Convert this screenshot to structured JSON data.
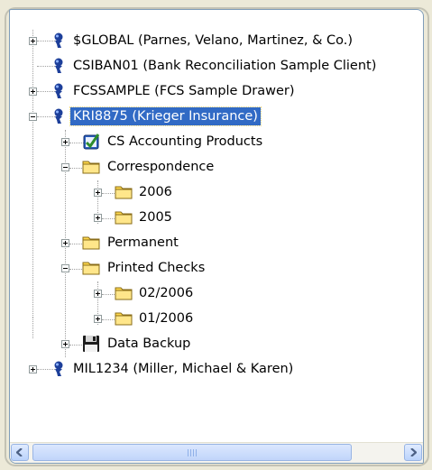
{
  "tree": {
    "items": [
      {
        "label": "$GLOBAL (Parnes, Velano, Martinez, & Co.)",
        "icon": "drawer-icon",
        "toggle": "plus"
      },
      {
        "label": "CSIBAN01 (Bank Reconciliation Sample Client)",
        "icon": "drawer-icon",
        "toggle": "none"
      },
      {
        "label": "FCSSAMPLE (FCS Sample Drawer)",
        "icon": "drawer-icon",
        "toggle": "plus"
      },
      {
        "label": "KRI8875 (Krieger Insurance)",
        "icon": "drawer-icon",
        "toggle": "minus",
        "selected": true
      },
      {
        "label": "CS Accounting Products",
        "icon": "cs-accounting-icon",
        "toggle": "plus"
      },
      {
        "label": "Correspondence",
        "icon": "folder-icon",
        "toggle": "minus"
      },
      {
        "label": "2006",
        "icon": "folder-icon",
        "toggle": "plus"
      },
      {
        "label": "2005",
        "icon": "folder-icon",
        "toggle": "plus"
      },
      {
        "label": "Permanent",
        "icon": "folder-icon",
        "toggle": "plus"
      },
      {
        "label": "Printed Checks",
        "icon": "folder-icon",
        "toggle": "minus"
      },
      {
        "label": "02/2006",
        "icon": "folder-icon",
        "toggle": "plus"
      },
      {
        "label": "01/2006",
        "icon": "folder-icon",
        "toggle": "plus"
      },
      {
        "label": "Data Backup",
        "icon": "floppy-disk-icon",
        "toggle": "plus"
      },
      {
        "label": "MIL1234 (Miller, Michael & Karen)",
        "icon": "drawer-icon",
        "toggle": "plus"
      }
    ]
  },
  "scrollbar": {
    "left_arrow": "scroll-left-icon",
    "right_arrow": "scroll-right-icon"
  },
  "colors": {
    "selection": "#316ac5",
    "folder": "#ffd84c",
    "drawer": "#1d3f9a",
    "panel_border": "#7f9db9"
  }
}
